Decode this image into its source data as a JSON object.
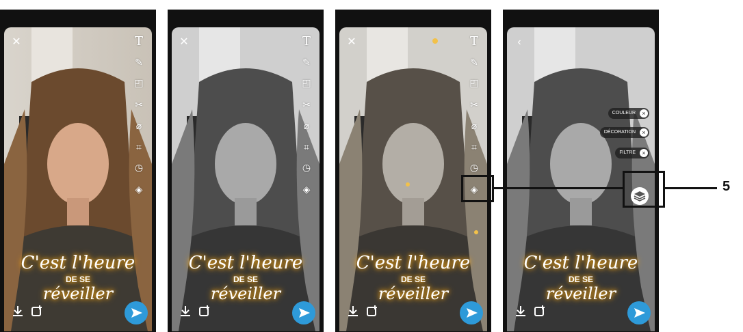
{
  "panels": [
    {
      "id": "panel-1",
      "filter": "color",
      "back_icon": "close-icon",
      "tools": [
        "text-tool-icon",
        "pencil-icon",
        "sticker-icon",
        "scissors-icon",
        "paperclip-icon",
        "crop-icon",
        "timer-icon",
        "layers-icon"
      ]
    },
    {
      "id": "panel-2",
      "filter": "bw",
      "back_icon": "close-icon",
      "tools": [
        "text-tool-icon",
        "pencil-icon",
        "sticker-icon",
        "scissors-icon",
        "paperclip-icon",
        "crop-icon",
        "timer-icon",
        "layers-icon"
      ]
    },
    {
      "id": "panel-3",
      "filter": "bw-sparkle",
      "back_icon": "close-icon",
      "tools": [
        "text-tool-icon",
        "pencil-icon",
        "sticker-icon",
        "scissors-icon",
        "paperclip-icon",
        "crop-icon",
        "timer-icon",
        "layers-icon"
      ]
    },
    {
      "id": "panel-4",
      "filter": "bw",
      "back_icon": "back-arrow-icon",
      "tools": [
        "layers-icon"
      ]
    }
  ],
  "overlay_text": {
    "line1": "C'est l'heure",
    "line2": "DE SE",
    "line3": "réveiller"
  },
  "layer_options": {
    "color": "COULEUR",
    "decoration": "DÉCORATION",
    "filter": "FILTRE"
  },
  "step_label": "5",
  "colors": {
    "send_button": "#2e9ad9",
    "glow": "#f2a312",
    "frame": "#111111"
  }
}
